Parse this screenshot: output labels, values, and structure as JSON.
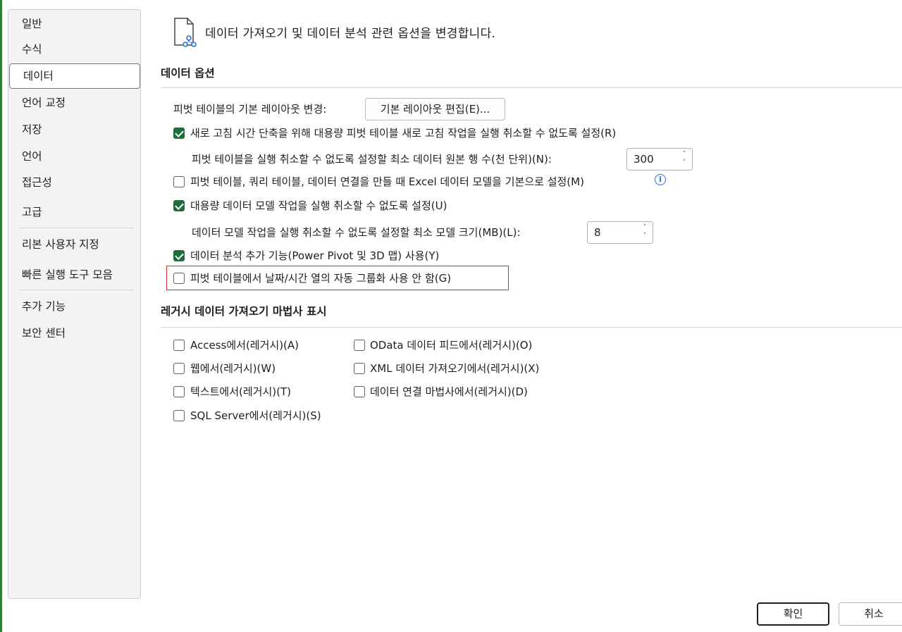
{
  "sidebar": {
    "items": [
      {
        "label": "일반"
      },
      {
        "label": "수식"
      },
      {
        "label": "데이터"
      },
      {
        "label": "언어 교정"
      },
      {
        "label": "저장"
      },
      {
        "label": "언어"
      },
      {
        "label": "접근성"
      },
      {
        "label": "고급"
      },
      {
        "label": "리본 사용자 지정"
      },
      {
        "label": "빠른 실행 도구 모음"
      },
      {
        "label": "추가 기능"
      },
      {
        "label": "보안 센터"
      }
    ],
    "selected": "데이터"
  },
  "header": {
    "icon": "document-data-icon",
    "text": "데이터 가져오기 및 데이터 분석 관련 옵션을 변경합니다."
  },
  "data_options": {
    "title": "데이터 옵션",
    "pivot_layout_label": "피벗 테이블의 기본 레이아웃 변경:",
    "pivot_layout_button": "기본 레이아웃 편집(E)...",
    "disable_undo_large_pivot": {
      "label": "새로 고침 시간 단축을 위해 대용량 피벗 테이블 새로 고침 작업을 실행 취소할 수 없도록 설정(R)",
      "checked": true
    },
    "min_rows_label": "피벗 테이블을 실행 취소할 수 없도록 설정할 최소 데이터 원본 행 수(천 단위)(N):",
    "min_rows_value": "300",
    "prefer_data_model": {
      "label": "피벗 테이블, 쿼리 테이블, 데이터 연결을 만들 때 Excel 데이터 모델을 기본으로 설정(M)",
      "checked": false
    },
    "disable_undo_data_model": {
      "label": "대용량 데이터 모델 작업을 실행 취소할 수 없도록 설정(U)",
      "checked": true
    },
    "min_model_size_label": "데이터 모델 작업을 실행 취소할 수 없도록 설정할 최소 모델 크기(MB)(L):",
    "min_model_size_value": "8",
    "enable_addins": {
      "label": "데이터 분석 추가 기능(Power Pivot 및 3D 맵) 사용(Y)",
      "checked": true
    },
    "disable_auto_grouping": {
      "label": "피벗 테이블에서 날짜/시간 열의 자동 그룹화 사용 안 함(G)",
      "checked": false
    }
  },
  "legacy": {
    "title": "레거시 데이터 가져오기 마법사 표시",
    "items": [
      {
        "label": "Access에서(레거시)(A)",
        "checked": false
      },
      {
        "label": "웹에서(레거시)(W)",
        "checked": false
      },
      {
        "label": "텍스트에서(레거시)(T)",
        "checked": false
      },
      {
        "label": "SQL Server에서(레거시)(S)",
        "checked": false
      },
      {
        "label": "OData 데이터 피드에서(레거시)(O)",
        "checked": false
      },
      {
        "label": "XML 데이터 가져오기에서(레거시)(X)",
        "checked": false
      },
      {
        "label": "데이터 연결 마법사에서(레거시)(D)",
        "checked": false
      }
    ]
  },
  "footer": {
    "ok": "확인",
    "cancel": "취소"
  },
  "colors": {
    "accent_green": "#1d6e3b",
    "highlight_red": "#d62a2a"
  }
}
